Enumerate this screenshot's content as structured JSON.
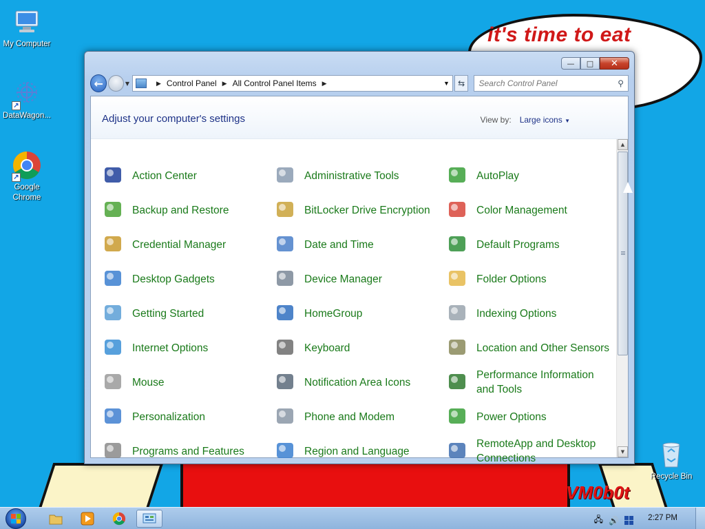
{
  "wallpaper": {
    "speech_text": "it's time to eat",
    "signature": "VM0b0t"
  },
  "desktop_icons": [
    {
      "label": "My Computer",
      "icon": "computer-icon"
    },
    {
      "label": "DataWagon...",
      "icon": "datawagon-icon"
    },
    {
      "label": "Google Chrome",
      "icon": "chrome-icon"
    },
    {
      "label": "Recycle Bin",
      "icon": "recycle-bin-icon"
    }
  ],
  "window": {
    "caption": {
      "minimize": "—",
      "maximize": "□",
      "close": "✕"
    },
    "address": {
      "crumbs": [
        "Control Panel",
        "All Control Panel Items"
      ]
    },
    "search": {
      "placeholder": "Search Control Panel"
    },
    "header": {
      "title": "Adjust your computer's settings",
      "view_by_label": "View by:",
      "view_by_value": "Large icons"
    },
    "items": [
      {
        "label": "Action Center",
        "icon": "flag-icon",
        "color": "#1f3f9a"
      },
      {
        "label": "Administrative Tools",
        "icon": "admin-tools-icon",
        "color": "#8a9bb0"
      },
      {
        "label": "AutoPlay",
        "icon": "autoplay-icon",
        "color": "#3aa03a"
      },
      {
        "label": "Backup and Restore",
        "icon": "backup-icon",
        "color": "#4aa336"
      },
      {
        "label": "BitLocker Drive Encryption",
        "icon": "bitlocker-icon",
        "color": "#c9a23a"
      },
      {
        "label": "Color Management",
        "icon": "color-management-icon",
        "color": "#d8473b"
      },
      {
        "label": "Credential Manager",
        "icon": "credential-icon",
        "color": "#c99a2e"
      },
      {
        "label": "Date and Time",
        "icon": "date-time-icon",
        "color": "#4a7fc9"
      },
      {
        "label": "Default Programs",
        "icon": "default-programs-icon",
        "color": "#2f8f3a"
      },
      {
        "label": "Desktop Gadgets",
        "icon": "gadgets-icon",
        "color": "#3b7fd0"
      },
      {
        "label": "Device Manager",
        "icon": "device-manager-icon",
        "color": "#7a8797"
      },
      {
        "label": "Folder Options",
        "icon": "folder-icon",
        "color": "#e5b94a"
      },
      {
        "label": "Getting Started",
        "icon": "getting-started-icon",
        "color": "#5a9fd6"
      },
      {
        "label": "HomeGroup",
        "icon": "homegroup-icon",
        "color": "#2f6fbf"
      },
      {
        "label": "Indexing Options",
        "icon": "indexing-icon",
        "color": "#9aa4ae"
      },
      {
        "label": "Internet Options",
        "icon": "internet-icon",
        "color": "#3a8fd6"
      },
      {
        "label": "Keyboard",
        "icon": "keyboard-icon",
        "color": "#6c6c6c"
      },
      {
        "label": "Location and Other Sensors",
        "icon": "sensors-icon",
        "color": "#8a8a5a"
      },
      {
        "label": "Mouse",
        "icon": "mouse-icon",
        "color": "#9a9a9a"
      },
      {
        "label": "Notification Area Icons",
        "icon": "notification-icon",
        "color": "#5a6a7a"
      },
      {
        "label": "Performance Information and Tools",
        "icon": "performance-icon",
        "color": "#2f7a2f"
      },
      {
        "label": "Personalization",
        "icon": "personalization-icon",
        "color": "#3f7fd0"
      },
      {
        "label": "Phone and Modem",
        "icon": "phone-icon",
        "color": "#8a96a6"
      },
      {
        "label": "Power Options",
        "icon": "power-icon",
        "color": "#3aa03a"
      },
      {
        "label": "Programs and Features",
        "icon": "programs-icon",
        "color": "#8a8a8a"
      },
      {
        "label": "Region and Language",
        "icon": "region-icon",
        "color": "#3a7fd0"
      },
      {
        "label": "RemoteApp and Desktop Connections",
        "icon": "remoteapp-icon",
        "color": "#3f6fb0"
      }
    ]
  },
  "taskbar": {
    "clock": "2:27 PM",
    "pinned": [
      "explorer-icon",
      "media-player-icon",
      "chrome-icon",
      "control-panel-icon"
    ]
  }
}
